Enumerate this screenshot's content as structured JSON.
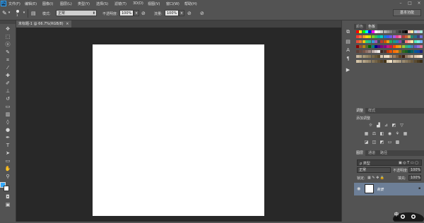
{
  "menu": {
    "logo": "Ps",
    "items": [
      "文件(F)",
      "编辑(E)",
      "图像(I)",
      "图层(L)",
      "类型(Y)",
      "选择(S)",
      "滤镜(T)",
      "3D(D)",
      "视图(V)",
      "窗口(W)",
      "帮助(H)"
    ]
  },
  "options": {
    "brush_size": "1",
    "mode_label": "模式:",
    "mode_value": "正常",
    "opacity_label": "不透明度:",
    "opacity_value": "100%",
    "flow_label": "流量:",
    "flow_value": "100%",
    "workspace": "基本功能"
  },
  "document": {
    "tab_title": "未标题-1 @ 66.7%(RGB/8)",
    "close": "×"
  },
  "panels": {
    "color_tabs": [
      "颜色",
      "色板"
    ],
    "adjust_tabs": [
      "调整",
      "样式"
    ],
    "adjust_title": "添加调整",
    "layer_tabs": [
      "图层",
      "通道",
      "路径"
    ],
    "layer_filter": "ρ 类型",
    "blend_mode": "正常",
    "opacity_label": "不透明度:",
    "opacity_value": "100%",
    "lock_label": "锁定:",
    "fill_label": "填充:",
    "fill_value": "100%",
    "layer_name": "背景"
  },
  "ime": {
    "label": "中"
  },
  "colors": {
    "accent": "#31a8ff",
    "canvas_bg": "#282828",
    "ui": "#535353",
    "selected_layer": "#6d7f97"
  }
}
